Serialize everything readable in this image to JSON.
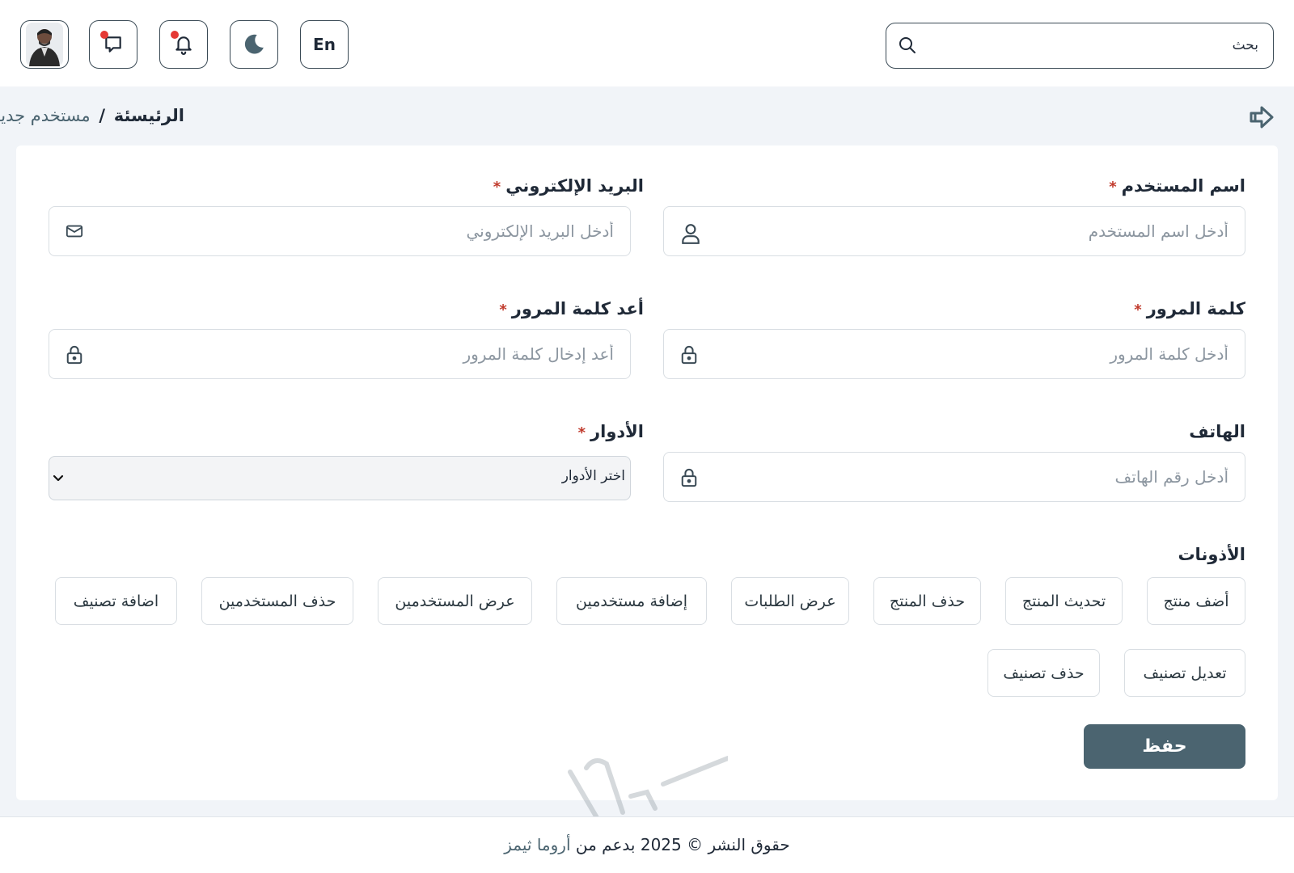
{
  "header": {
    "language_label": "En",
    "search_placeholder": "بحث",
    "icons": {
      "language": "language-toggle",
      "theme": "moon-icon",
      "notifications": "bell-icon",
      "messages": "chat-icon",
      "avatar": "user-avatar"
    }
  },
  "breadcrumb": {
    "home": "الرئيسئة",
    "separator": "/",
    "current": "مستخدم جديد"
  },
  "form": {
    "username": {
      "label": "اسم المستخدم",
      "required": "*",
      "placeholder": "أدخل اسم المستخدم",
      "icon": "user-icon"
    },
    "email": {
      "label": "البريد الإلكتروني",
      "required": "*",
      "placeholder": "أدخل البريد الإلكتروني",
      "icon": "mail-icon"
    },
    "password": {
      "label": "كلمة المرور",
      "required": "*",
      "placeholder": "أدخل كلمة المرور",
      "icon": "lock-icon"
    },
    "confirm_password": {
      "label": "أعد كلمة المرور",
      "required": "*",
      "placeholder": "أعد إدخال كلمة المرور",
      "icon": "lock-icon"
    },
    "phone": {
      "label": "الهاتف",
      "placeholder": "أدخل رقم الهاتف",
      "icon": "lock-icon"
    },
    "roles": {
      "label": "الأدوار",
      "required": "*",
      "selected": "اختر الأدوار"
    },
    "permissions": {
      "label": "الأذونات",
      "items": [
        "أضف منتج",
        "تحديث المنتج",
        "حذف المنتج",
        "عرض الطلبات",
        "إضافة مستخدمين",
        "عرض المستخدمين",
        "حذف المستخدمين",
        "اضافة تصنيف",
        "تعديل تصنيف",
        "حذف تصنيف"
      ]
    },
    "save_label": "حفظ"
  },
  "footer": {
    "copyright": "حقوق النشر © 2025 بدعم من",
    "brand": "أروما ثيمز"
  },
  "colors": {
    "primary": "#4b6470",
    "required": "#c0392b",
    "notification_dot": "#e53935",
    "page_bg": "#f1f4f8"
  }
}
